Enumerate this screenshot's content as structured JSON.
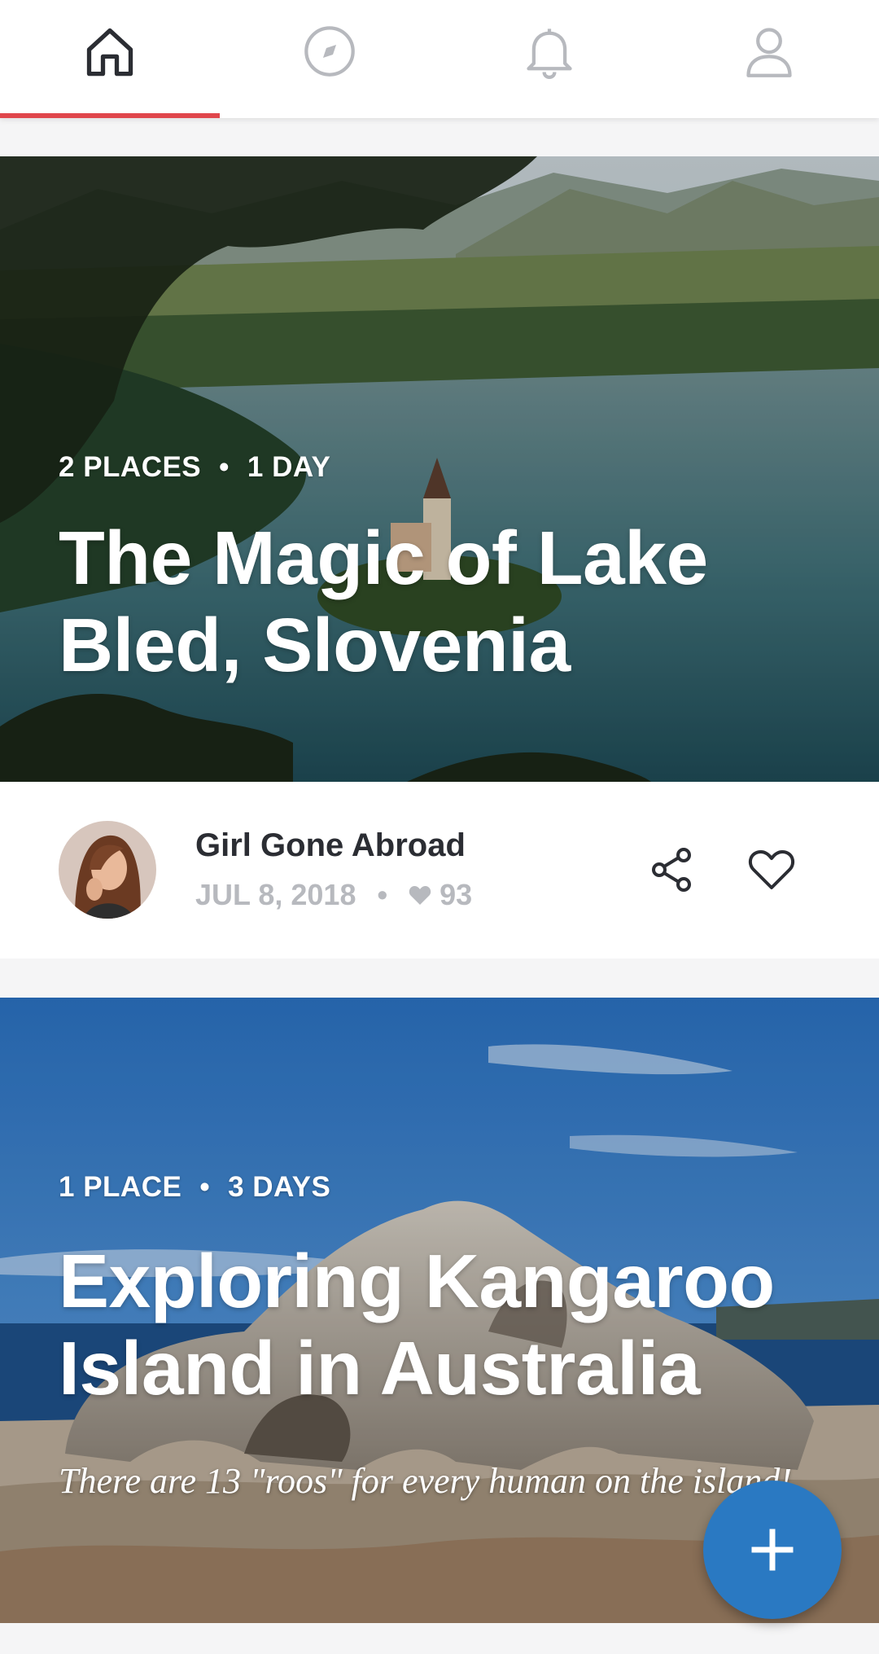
{
  "nav": {
    "tabs": [
      {
        "icon": "home-icon",
        "active": true
      },
      {
        "icon": "compass-icon",
        "active": false
      },
      {
        "icon": "bell-icon",
        "active": false
      },
      {
        "icon": "profile-icon",
        "active": false
      }
    ],
    "active_color": "#e0474c"
  },
  "cards": [
    {
      "places": "2 PLACES",
      "days": "1 DAY",
      "separator": "•",
      "title": "The Magic of Lake Bled, Slovenia",
      "author": {
        "name": "Girl Gone Abroad",
        "date": "JUL 8, 2018",
        "separator": "•",
        "likes": "93"
      }
    },
    {
      "places": "1 PLACE",
      "days": "3 DAYS",
      "separator": "•",
      "title": "Exploring Kangaroo Island in Australia",
      "subtitle": "There are 13 \"roos\" for every human on the island!"
    }
  ],
  "fab": {
    "icon": "plus-icon",
    "color": "#2a79c2"
  }
}
